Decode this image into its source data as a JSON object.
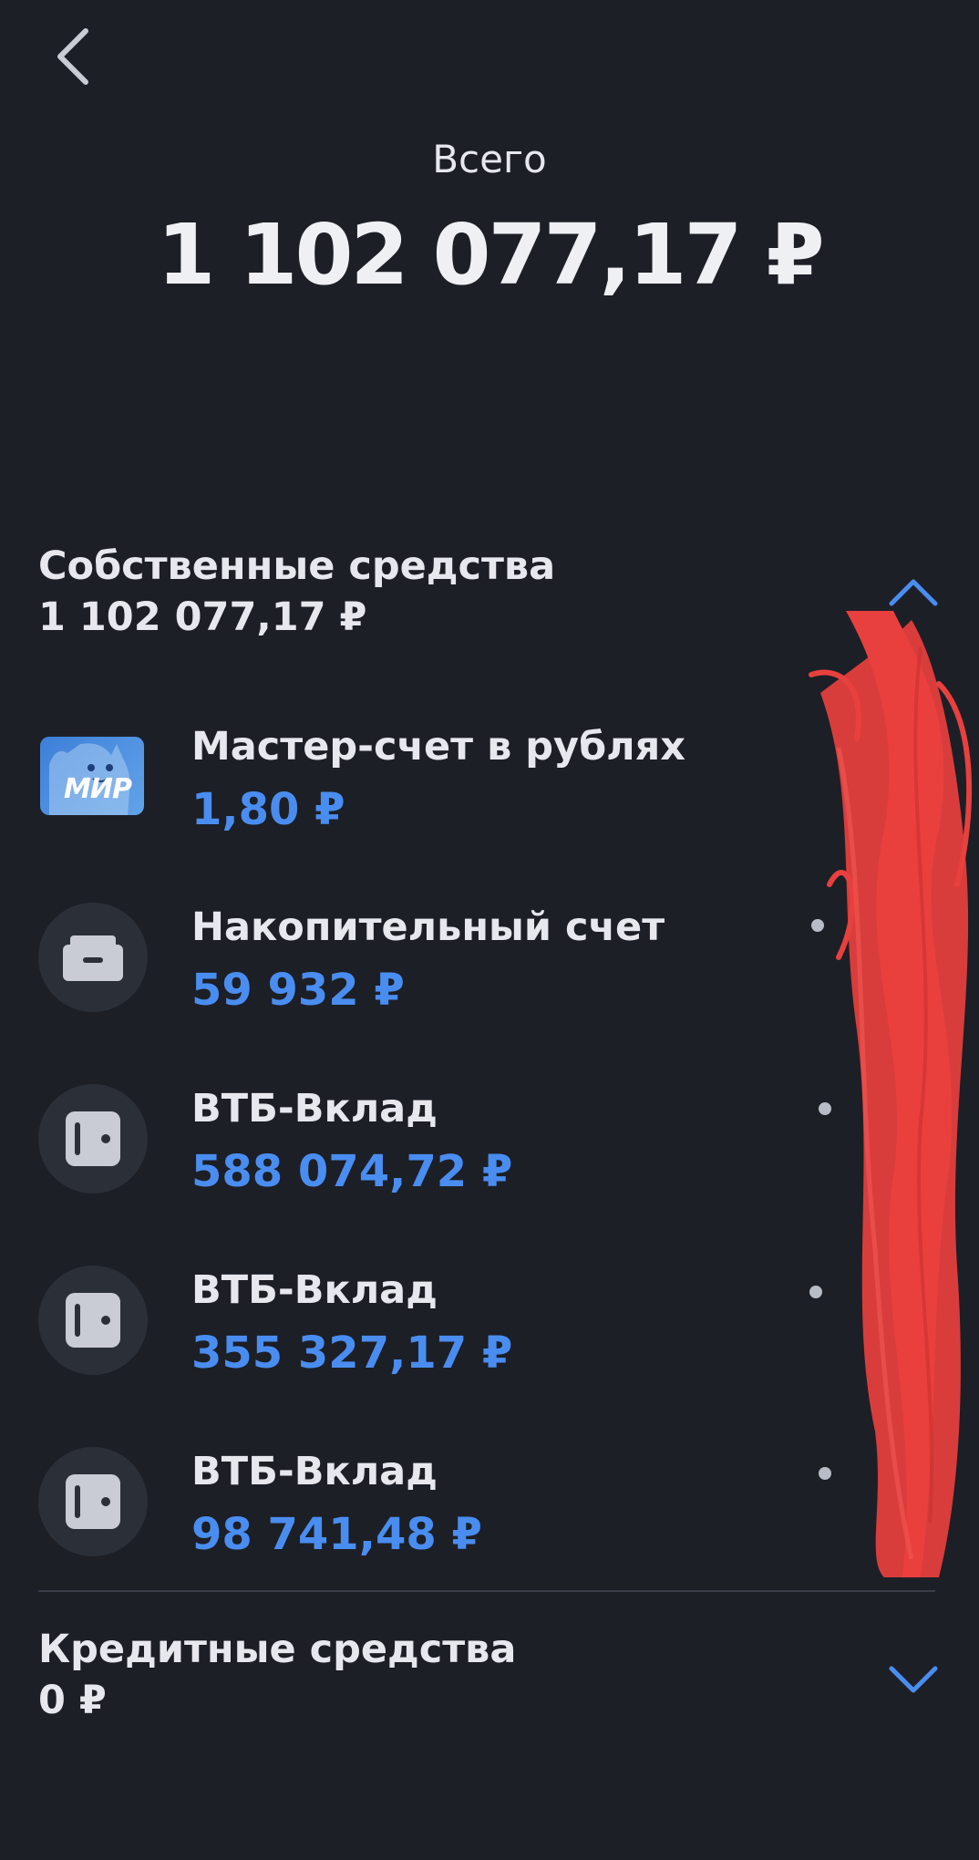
{
  "header": {
    "back_icon": "chevron-left-icon",
    "total_label": "Всего",
    "total_amount": "1 102 077,17 ₽"
  },
  "own_funds": {
    "title": "Собственные средства",
    "amount": "1 102 077,17 ₽",
    "toggle_icon": "chevron-up-icon",
    "accounts": [
      {
        "name": "Мастер-счет в рублях",
        "balance": "1,80 ₽",
        "icon": "mir-card-icon",
        "card_text": "МИР"
      },
      {
        "name": "Накопительный счет",
        "balance": "59 932 ₽",
        "icon": "wallet-icon"
      },
      {
        "name": "ВТБ-Вклад",
        "balance": "588 074,72 ₽",
        "icon": "safe-icon"
      },
      {
        "name": "ВТБ-Вклад",
        "balance": "355 327,17 ₽",
        "icon": "safe-icon"
      },
      {
        "name": "ВТБ-Вклад",
        "balance": "98 741,48 ₽",
        "icon": "safe-icon"
      }
    ]
  },
  "credit_funds": {
    "title": "Кредитные средства",
    "amount": "0 ₽",
    "toggle_icon": "chevron-down-icon"
  },
  "colors": {
    "background": "#1c1f26",
    "accent": "#4a8df0",
    "text": "#e6e8ee",
    "icon_bg": "#2b2f38",
    "redaction": "#e8403e"
  }
}
